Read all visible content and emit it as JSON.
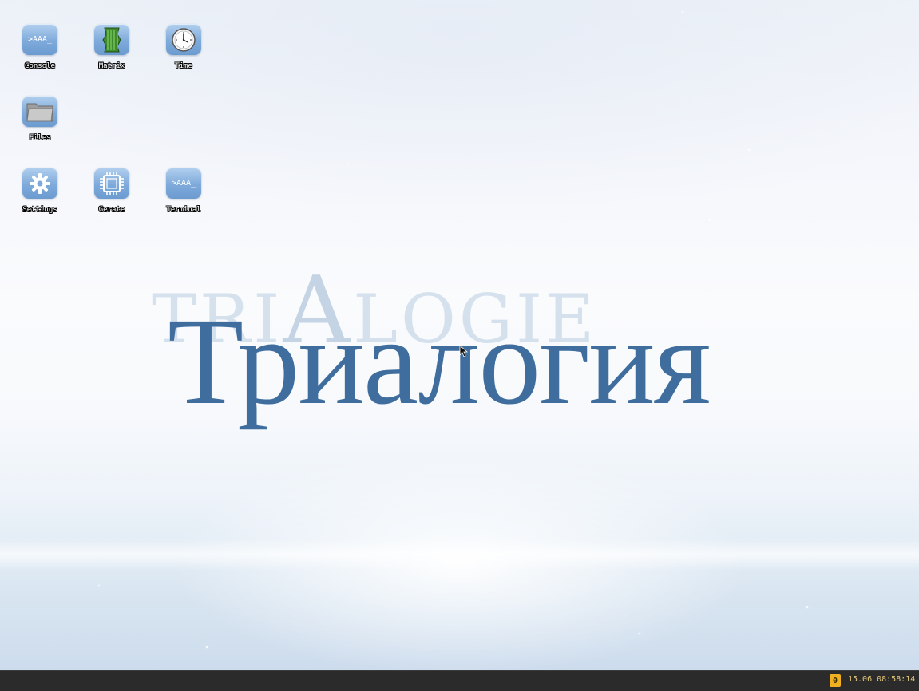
{
  "desktop": {
    "icons": [
      {
        "label": "Console",
        "glyph": ">AAA_",
        "icon": "console-icon"
      },
      {
        "label": "Matrix",
        "icon": "matrix-icon"
      },
      {
        "label": "Time",
        "icon": "clock-icon"
      },
      {
        "label": "Files",
        "icon": "folder-icon"
      },
      {
        "label": "Settings",
        "icon": "gear-icon"
      },
      {
        "label": "Gerate",
        "icon": "chip-icon"
      },
      {
        "label": "Terminal",
        "glyph": ">AAA_",
        "icon": "terminal-icon"
      }
    ]
  },
  "logo": {
    "background_text": "TRIALOGIE",
    "foreground_text": "Триалогия",
    "colors": {
      "foreground": "#3f6e9e",
      "background": "#b6cce0"
    }
  },
  "taskbar": {
    "notification_count": "0",
    "clock": "15.06 08:58:14",
    "colors": {
      "background": "#2b2b2b",
      "badge": "#f0b020",
      "clock_text": "#e6c87a"
    }
  }
}
